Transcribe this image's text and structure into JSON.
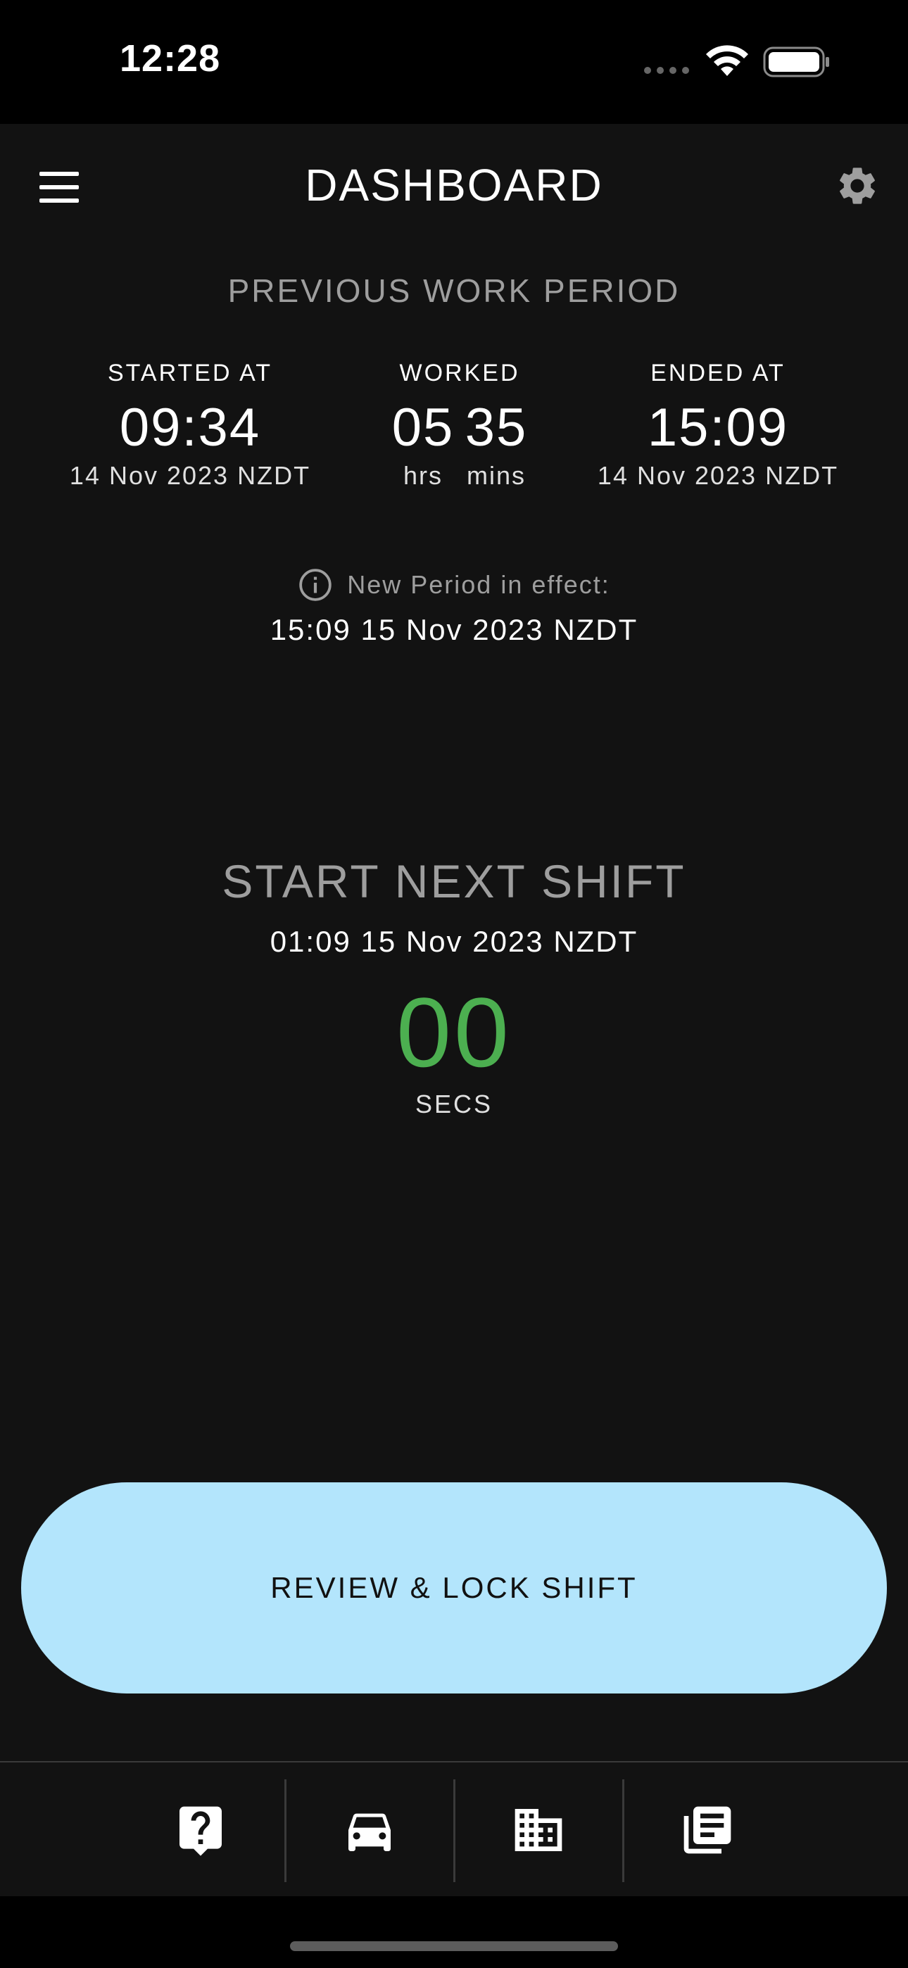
{
  "status_bar": {
    "time": "12:28"
  },
  "header": {
    "title": "DASHBOARD",
    "menu_icon": "hamburger-menu-icon",
    "settings_icon": "gear-icon"
  },
  "previous_period": {
    "heading": "PREVIOUS WORK PERIOD",
    "started": {
      "label": "STARTED AT",
      "time": "09:34",
      "date": "14 Nov 2023 NZDT"
    },
    "worked": {
      "label": "WORKED",
      "hours": "05",
      "minutes": "35",
      "hours_unit": "hrs",
      "minutes_unit": "mins"
    },
    "ended": {
      "label": "ENDED AT",
      "time": "15:09",
      "date": "14 Nov 2023 NZDT"
    },
    "new_period": {
      "label": "New Period in effect:",
      "date": "15:09 15 Nov 2023 NZDT",
      "icon": "info-icon"
    }
  },
  "next_shift": {
    "title": "START NEXT SHIFT",
    "date": "01:09 15 Nov 2023 NZDT",
    "countdown_value": "00",
    "countdown_unit": "SECS",
    "countdown_color": "#4caf50"
  },
  "primary_action": {
    "label": "REVIEW & LOCK SHIFT",
    "color": "#b3e5fc"
  },
  "bottom_nav": {
    "items": [
      {
        "icon": "help-question-icon"
      },
      {
        "icon": "car-icon"
      },
      {
        "icon": "building-icon"
      },
      {
        "icon": "records-list-icon"
      }
    ]
  },
  "theme": {
    "background": "#121212",
    "muted_text": "#9e9e9e"
  }
}
